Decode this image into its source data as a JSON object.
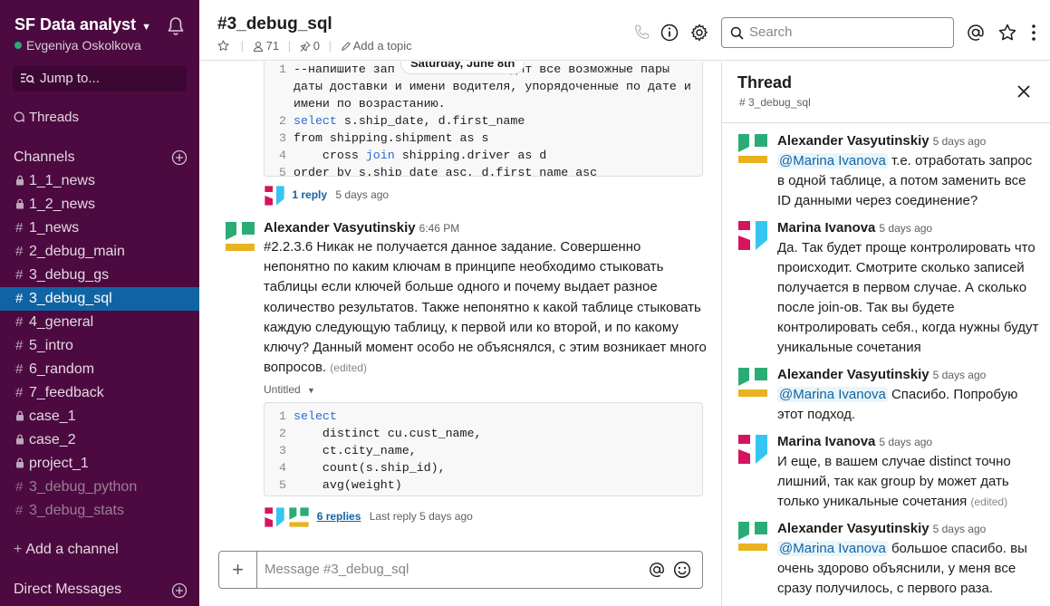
{
  "workspace": {
    "name": "SF Data analyst",
    "user": "Evgeniya Oskolkova"
  },
  "sidebar": {
    "jump_label": "Jump to...",
    "threads_label": "Threads",
    "channels_heading": "Channels",
    "channels": [
      {
        "prefix": "lock",
        "name": "1_1_news",
        "state": "normal"
      },
      {
        "prefix": "lock",
        "name": "1_2_news",
        "state": "normal"
      },
      {
        "prefix": "hash",
        "name": "1_news",
        "state": "normal"
      },
      {
        "prefix": "hash",
        "name": "2_debug_main",
        "state": "normal"
      },
      {
        "prefix": "hash",
        "name": "3_debug_gs",
        "state": "normal"
      },
      {
        "prefix": "hash",
        "name": "3_debug_sql",
        "state": "active"
      },
      {
        "prefix": "hash",
        "name": "4_general",
        "state": "normal"
      },
      {
        "prefix": "hash",
        "name": "5_intro",
        "state": "normal"
      },
      {
        "prefix": "hash",
        "name": "6_random",
        "state": "normal"
      },
      {
        "prefix": "hash",
        "name": "7_feedback",
        "state": "normal"
      },
      {
        "prefix": "lock",
        "name": "case_1",
        "state": "normal"
      },
      {
        "prefix": "lock",
        "name": "case_2",
        "state": "normal"
      },
      {
        "prefix": "lock",
        "name": "project_1",
        "state": "normal"
      },
      {
        "prefix": "hash",
        "name": "3_debug_python",
        "state": "muted"
      },
      {
        "prefix": "hash",
        "name": "3_debug_stats",
        "state": "muted"
      }
    ],
    "add_channel": "Add a channel",
    "dm_heading": "Direct Messages"
  },
  "header": {
    "channel": "#3_debug_sql",
    "members": "71",
    "pins": "0",
    "add_topic": "Add a topic",
    "search_placeholder": "Search"
  },
  "messages": {
    "date_pill": "Saturday, June 8th",
    "code1": [
      {
        "n": "1",
        "segs": [
          {
            "t": "--напишите зап",
            "k": false
          },
          {
            "t": "                ",
            "k": false
          },
          {
            "t": "дит все возможные пары",
            "k": false
          }
        ]
      },
      {
        "n": "",
        "segs": [
          {
            "t": "даты доставки и имени водителя, упорядоченные по дате и",
            "k": false
          }
        ]
      },
      {
        "n": "",
        "segs": [
          {
            "t": "имени по возрастанию.",
            "k": false
          }
        ]
      },
      {
        "n": "2",
        "segs": [
          {
            "t": "select",
            "k": true
          },
          {
            "t": " s.ship_date, d.first_name",
            "k": false
          }
        ]
      },
      {
        "n": "3",
        "segs": [
          {
            "t": "from shipping.shipment as s",
            "k": false
          }
        ]
      },
      {
        "n": "4",
        "segs": [
          {
            "t": "    cross ",
            "k": false
          },
          {
            "t": "join",
            "k": true
          },
          {
            "t": " shipping.driver as d",
            "k": false
          }
        ]
      },
      {
        "n": "5",
        "segs": [
          {
            "t": "order by s.ship_date asc, d.first_name asc",
            "k": false
          }
        ]
      }
    ],
    "reply1": {
      "link": "1 reply",
      "time": "5 days ago"
    },
    "msg": {
      "author": "Alexander Vasyutinskiy",
      "time": "6:46 PM",
      "body": "#2.2.3.6 Никак не получается данное задание. Совершенно непонятно по каким ключам в принципе необходимо стыковать таблицы если ключей больше одного и почему выдает разное количество результатов. Также непонятно к какой таблице стыковать каждую следующую таблицу, к первой или ко второй, и по какому ключу? Данный момент особо не объяснялся, с этим возникает много вопросов.",
      "edited": "(edited)"
    },
    "snippet_title": "Untitled",
    "code2": [
      {
        "n": "1",
        "segs": [
          {
            "t": "select",
            "k": true
          }
        ]
      },
      {
        "n": "2",
        "segs": [
          {
            "t": "    distinct cu.cust_name,",
            "k": false
          }
        ]
      },
      {
        "n": "3",
        "segs": [
          {
            "t": "    ct.city_name,",
            "k": false
          }
        ]
      },
      {
        "n": "4",
        "segs": [
          {
            "t": "    count(s.ship_id),",
            "k": false
          }
        ]
      },
      {
        "n": "5",
        "segs": [
          {
            "t": "    avg(weight)",
            "k": false
          }
        ]
      }
    ],
    "reply2": {
      "link": "6 replies",
      "time": "Last reply 5 days ago"
    }
  },
  "composer": {
    "placeholder": "Message #3_debug_sql"
  },
  "thread": {
    "title": "Thread",
    "channel": "# 3_debug_sql",
    "items": [
      {
        "author": "Alexander Vasyutinskiy",
        "time": "5 days ago",
        "avatar": "green",
        "mention": "@Marina Ivanova",
        "text": " т.е. отработать запрос в одной таблице, а потом заменить все ID данными через соединение?",
        "edited": ""
      },
      {
        "author": "Marina Ivanova",
        "time": "5 days ago",
        "avatar": "pink",
        "mention": "",
        "text": "Да. Так будет проще контролировать что происходит. Смотрите сколько записей получается в первом случае. А сколько после join-ов. Так вы будете контролировать себя., когда нужны будут уникальные сочетания",
        "edited": ""
      },
      {
        "author": "Alexander Vasyutinskiy",
        "time": "5 days ago",
        "avatar": "green",
        "mention": "@Marina Ivanova",
        "text": " Спасибо. Попробую этот подход.",
        "edited": ""
      },
      {
        "author": "Marina Ivanova",
        "time": "5 days ago",
        "avatar": "pink",
        "mention": "",
        "text": "И еще, в вашем случае distinct точно лишний, так как group by может дать только уникальные сочетания",
        "edited": "(edited)"
      },
      {
        "author": "Alexander Vasyutinskiy",
        "time": "5 days ago",
        "avatar": "green",
        "mention": "@Marina Ivanova",
        "text": " большое спасибо. вы очень здорово объяснили, у меня все сразу получилось, с первого раза.",
        "edited": ""
      }
    ]
  },
  "colors": {
    "sidebar": "#4d0a40",
    "active": "#1164a3",
    "link": "#1264a3",
    "green_avatar": "#2bac76",
    "yellow_avatar": "#e8b221",
    "pink_avatar": "#d6135f",
    "blue_avatar": "#36c5f0"
  }
}
